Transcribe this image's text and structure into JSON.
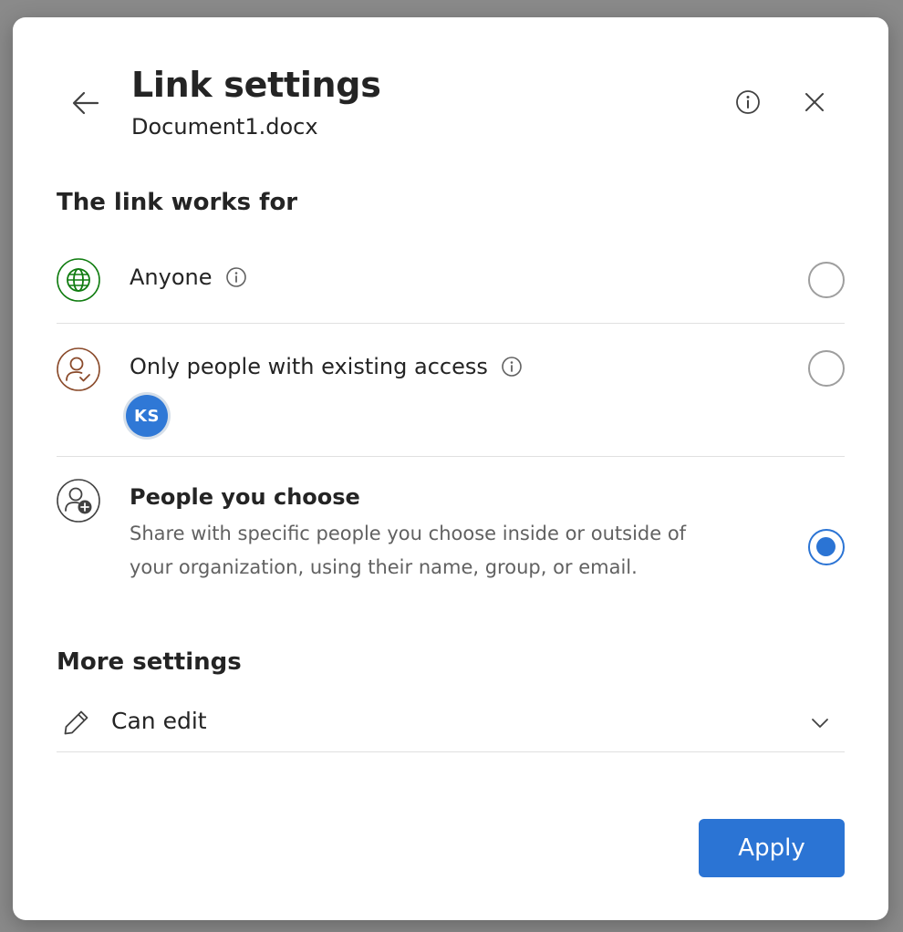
{
  "header": {
    "title": "Link settings",
    "subtitle": "Document1.docx"
  },
  "link_works_for": {
    "heading": "The link works for",
    "options": [
      {
        "label": "Anyone",
        "icon": "globe-icon",
        "has_info": true,
        "selected": false,
        "accent": "#107c10"
      },
      {
        "label": "Only people with existing access",
        "icon": "person-check-icon",
        "has_info": true,
        "selected": false,
        "accent": "#8a4a2a",
        "avatar_initials": "KS"
      },
      {
        "label": "People you choose",
        "icon": "person-add-icon",
        "has_info": false,
        "selected": true,
        "description": "Share with specific people you choose inside or outside of your organization, using their name, group, or email."
      }
    ]
  },
  "more_settings": {
    "heading": "More settings",
    "permission": "Can edit",
    "permission_icon": "pencil-icon"
  },
  "footer": {
    "apply_label": "Apply"
  },
  "colors": {
    "accent": "#2b74d4",
    "avatar": "#2f78d6"
  }
}
